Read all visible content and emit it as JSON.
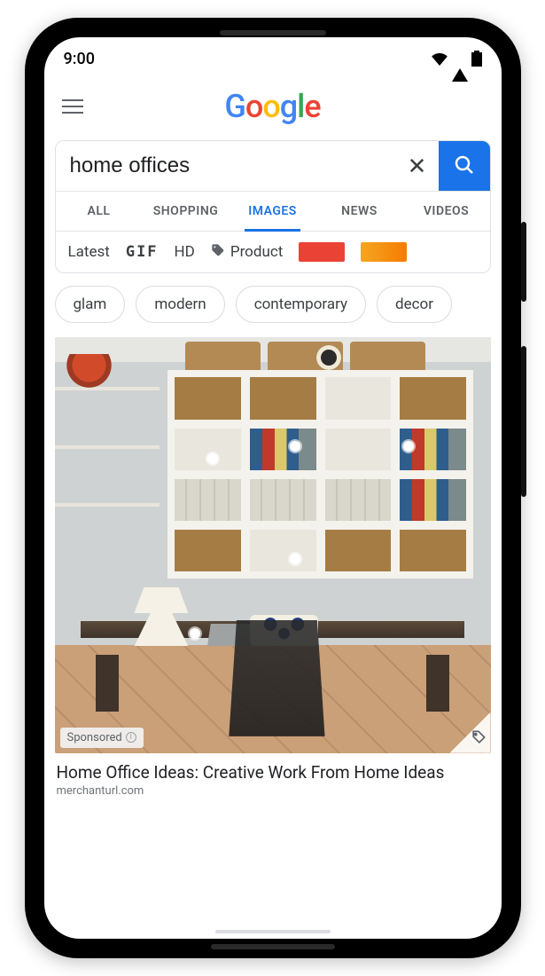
{
  "status": {
    "time": "9:00"
  },
  "logo_letters": [
    "G",
    "o",
    "o",
    "g",
    "l",
    "e"
  ],
  "search": {
    "query": "home offices",
    "tabs": [
      {
        "label": "ALL",
        "active": false
      },
      {
        "label": "SHOPPING",
        "active": false
      },
      {
        "label": "IMAGES",
        "active": true
      },
      {
        "label": "NEWS",
        "active": false
      },
      {
        "label": "VIDEOS",
        "active": false
      }
    ],
    "filters": {
      "latest": "Latest",
      "gif": "GIF",
      "hd": "HD",
      "product": "Product",
      "swatches": [
        {
          "name": "red",
          "color": "#ea4335"
        },
        {
          "name": "orange",
          "color": "linear-gradient(90deg,#f5a623,#f57c00)"
        }
      ]
    }
  },
  "chips": [
    "glam",
    "modern",
    "contemporary",
    "decor"
  ],
  "result": {
    "sponsored_label": "Sponsored",
    "title": "Home Office Ideas: Creative Work From Home Ideas",
    "source": "merchanturl.com",
    "hotspots": 5
  }
}
